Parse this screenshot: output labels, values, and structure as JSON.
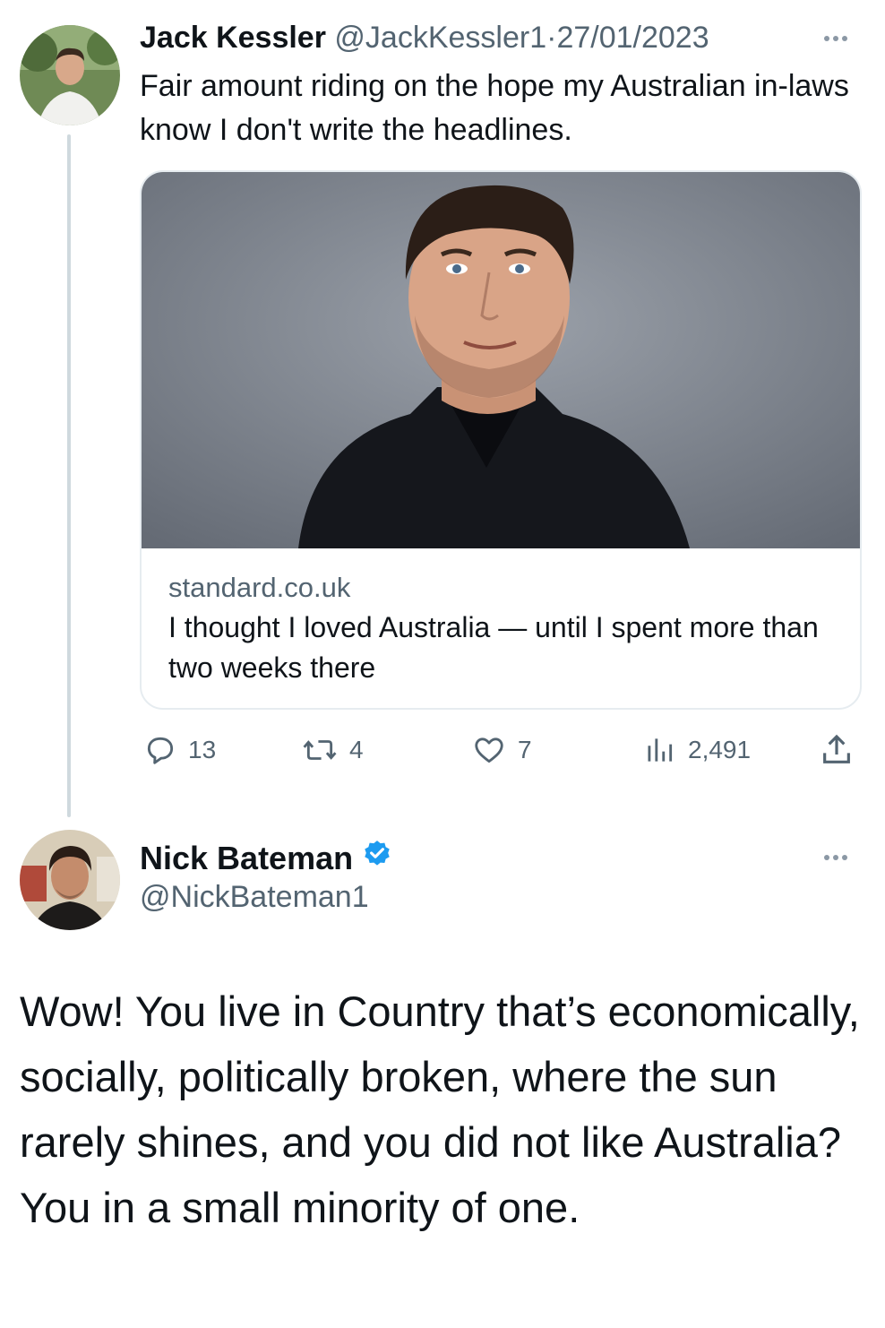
{
  "tweet1": {
    "author_name": "Jack Kessler",
    "handle": "@JackKessler1",
    "separator": "·",
    "date": "27/01/2023",
    "text": "Fair amount riding on the hope my Australian in-laws know I don't write the headlines.",
    "card": {
      "domain": "standard.co.uk",
      "title": "I thought I loved Australia — until I spent more than two weeks there"
    },
    "actions": {
      "replies": "13",
      "retweets": "4",
      "likes": "7",
      "views": "2,491"
    }
  },
  "tweet2": {
    "author_name": "Nick Bateman",
    "handle": "@NickBateman1",
    "text": "Wow! You live in Country that’s economically, socially, politically broken, where the sun rarely shines, and you did not like Australia? You in a small minority of one."
  },
  "colors": {
    "primary_text": "#0f1419",
    "secondary_text": "#536471",
    "verified_blue": "#1d9bf0",
    "thread_line": "#cfd9de"
  },
  "icons": [
    "more-icon",
    "reply-icon",
    "retweet-icon",
    "like-icon",
    "views-icon",
    "share-icon",
    "verified-badge-icon"
  ]
}
